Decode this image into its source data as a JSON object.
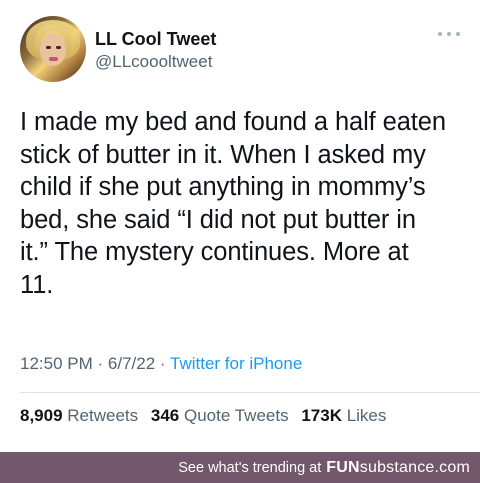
{
  "tweet": {
    "display_name": "LL Cool Tweet",
    "handle": "@LLcoooltweet",
    "text": "I made my bed and found a half eaten\nstick of butter in it. When I asked my\nchild if she put anything in mommy’s\nbed, she said “I did not put butter in\nit.” The mystery continues. More at\n11.",
    "time": "12:50 PM",
    "date": "6/7/22",
    "separator": "·",
    "source": "Twitter for iPhone",
    "stats": {
      "retweets_count": "8,909",
      "retweets_label": "Retweets",
      "quotes_count": "346",
      "quotes_label": "Quote Tweets",
      "likes_count": "173K",
      "likes_label": "Likes"
    }
  },
  "banner": {
    "text": "See what's trending at",
    "brand_fun": "FUN",
    "brand_sub": "substance",
    "brand_tld": ".com",
    "bg_color": "#73576a"
  },
  "icons": {
    "more": "more-horizontal-icon",
    "avatar": "profile-avatar"
  }
}
